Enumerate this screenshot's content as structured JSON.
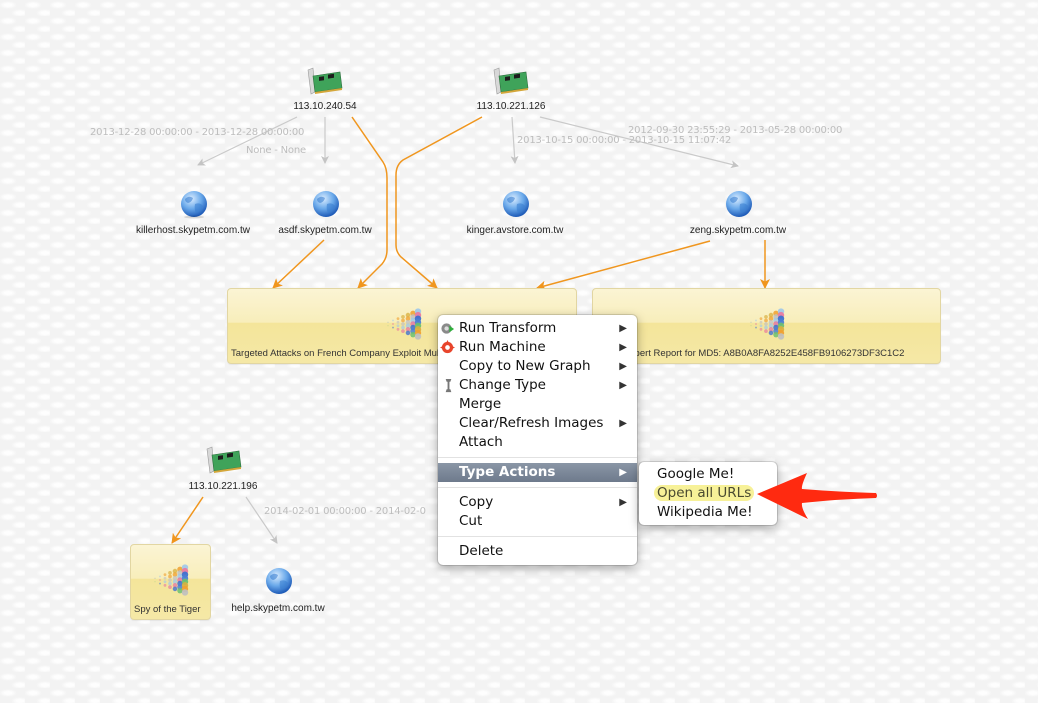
{
  "graph": {
    "ip_nodes": [
      {
        "id": "ip1",
        "label": "113.10.240.54",
        "icon": "network-card-icon"
      },
      {
        "id": "ip2",
        "label": "113.10.221.126",
        "icon": "network-card-icon"
      },
      {
        "id": "ip3",
        "label": "113.10.221.196",
        "icon": "network-card-icon"
      }
    ],
    "domain_nodes": [
      {
        "id": "d1",
        "label": "killerhost.skypetm.com.tw",
        "icon": "globe-icon"
      },
      {
        "id": "d2",
        "label": "asdf.skypetm.com.tw",
        "icon": "globe-icon"
      },
      {
        "id": "d3",
        "label": "kinger.avstore.com.tw",
        "icon": "globe-icon"
      },
      {
        "id": "d4",
        "label": "zeng.skypetm.com.tw",
        "icon": "globe-icon"
      },
      {
        "id": "d5",
        "label": "help.skypetm.com.tw",
        "icon": "globe-icon"
      }
    ],
    "document_nodes": [
      {
        "id": "doc1",
        "label": "Targeted Attacks on French Company Exploit Multiple Zero-Day Vulnerabilities",
        "icon": "threat-report-icon"
      },
      {
        "id": "doc2",
        "label": "ThreatExpert Report for MD5: A8B0A8FA8252E458FB9106273DF3C1C2",
        "icon": "threat-report-icon"
      },
      {
        "id": "doc3",
        "label": "Spy of the Tiger",
        "icon": "threat-report-icon"
      }
    ],
    "edge_labels": [
      {
        "id": "e1",
        "text": "2013-12-28 00:00:00 - 2013-12-28 00:00:00"
      },
      {
        "id": "e2",
        "text": "None - None"
      },
      {
        "id": "e3",
        "text": "2013-10-15 00:00:00 - 2013-10-15 11:07:42"
      },
      {
        "id": "e4",
        "text": "2012-09-30 23:55:29 - 2013-05-28 00:00:00"
      },
      {
        "id": "e5",
        "text": "2014-02-01 00:00:00 - 2014-02-0"
      }
    ],
    "colors": {
      "link_strong": "#f0961e",
      "link_weak": "#c8c8c8"
    }
  },
  "context_menu": {
    "groups": [
      [
        {
          "label": "Run Transform",
          "icon": "gear-transform-icon",
          "submenu": true
        },
        {
          "label": "Run Machine",
          "icon": "machine-gear-icon",
          "submenu": true
        },
        {
          "label": "Copy to New Graph",
          "submenu": true
        },
        {
          "label": "Change Type",
          "icon": "bone-icon",
          "submenu": true
        },
        {
          "label": "Merge",
          "submenu": false
        },
        {
          "label": "Clear/Refresh Images",
          "submenu": true
        },
        {
          "label": "Attach",
          "submenu": false
        }
      ],
      [
        {
          "label": "Type Actions",
          "submenu": true,
          "highlighted": true
        }
      ],
      [
        {
          "label": "Copy",
          "submenu": true
        },
        {
          "label": "Cut",
          "submenu": false
        }
      ],
      [
        {
          "label": "Delete",
          "submenu": false
        }
      ]
    ],
    "submenu_arrow": "▶"
  },
  "type_actions_submenu": {
    "items": [
      {
        "label": "Google Me!"
      },
      {
        "label": "Open all URLs",
        "highlighted": true
      },
      {
        "label": "Wikipedia Me!"
      }
    ]
  },
  "annotation": {
    "arrow_color": "#ff2a10",
    "highlight_color": "#f7f198"
  }
}
